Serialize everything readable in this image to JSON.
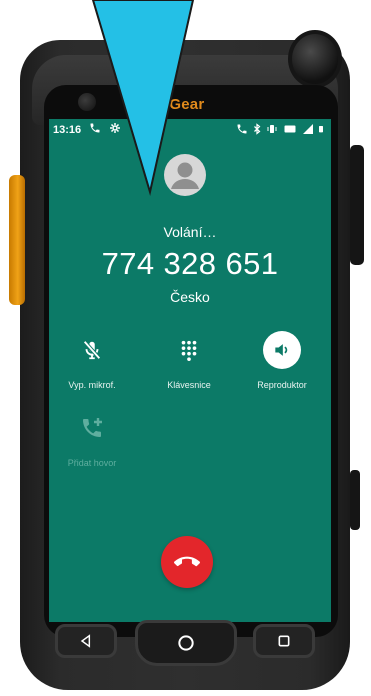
{
  "statusbar": {
    "time": "13:16"
  },
  "device": {
    "brand_prefix": "g",
    "brand_suffix": "Gear"
  },
  "call": {
    "status": "Volání…",
    "number": "774 328 651",
    "country": "Česko"
  },
  "controls": {
    "mute_label": "Vyp. mikrof.",
    "keypad_label": "Klávesnice",
    "speaker_label": "Reproduktor",
    "add_call_label": "Přidat hovor"
  },
  "colors": {
    "screen_bg": "#0c7a67",
    "end_call": "#e3262b",
    "pointer": "#24c0e6",
    "side_key": "#f0a217"
  },
  "icons": {
    "mute": "microphone-off-icon",
    "keypad": "dialpad-icon",
    "speaker": "speaker-icon",
    "add_call": "add-call-icon",
    "end_call": "hang-up-icon",
    "back": "back-triangle-icon",
    "home": "home-circle-icon",
    "recents": "recents-square-icon"
  }
}
